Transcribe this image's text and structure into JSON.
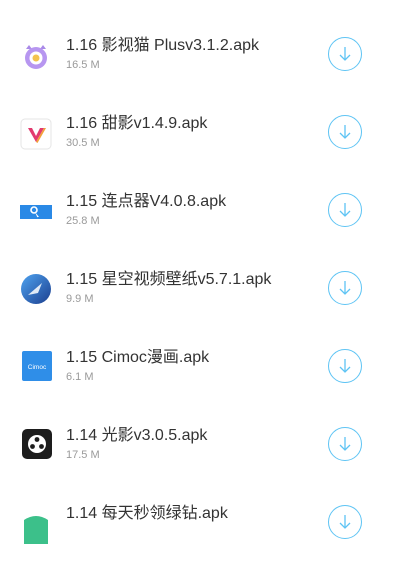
{
  "colors": {
    "accent": "#5ec4f4",
    "name_text": "#333333",
    "size_text": "#9a9a9a"
  },
  "items": [
    {
      "name": "1.16 影视猫 Plusv3.1.2.apk",
      "size": "16.5 M",
      "icon": "cat-app-icon"
    },
    {
      "name": "1.16 甜影v1.4.9.apk",
      "size": "30.5 M",
      "icon": "v-app-icon"
    },
    {
      "name": "1.15 连点器V4.0.8.apk",
      "size": "25.8 M",
      "icon": "auto-clicker-app-icon"
    },
    {
      "name": "1.15 星空视频壁纸v5.7.1.apk",
      "size": "9.9 M",
      "icon": "starry-wallpaper-app-icon"
    },
    {
      "name": "1.15 Cimoc漫画.apk",
      "size": "6.1 M",
      "icon": "cimoc-app-icon"
    },
    {
      "name": "1.14 光影v3.0.5.apk",
      "size": "17.5 M",
      "icon": "film-reel-app-icon"
    },
    {
      "name": "1.14 每天秒领绿钻.apk",
      "size": "",
      "icon": "green-app-icon"
    }
  ],
  "icon_texts": {
    "cimoc": "Cimoc"
  }
}
